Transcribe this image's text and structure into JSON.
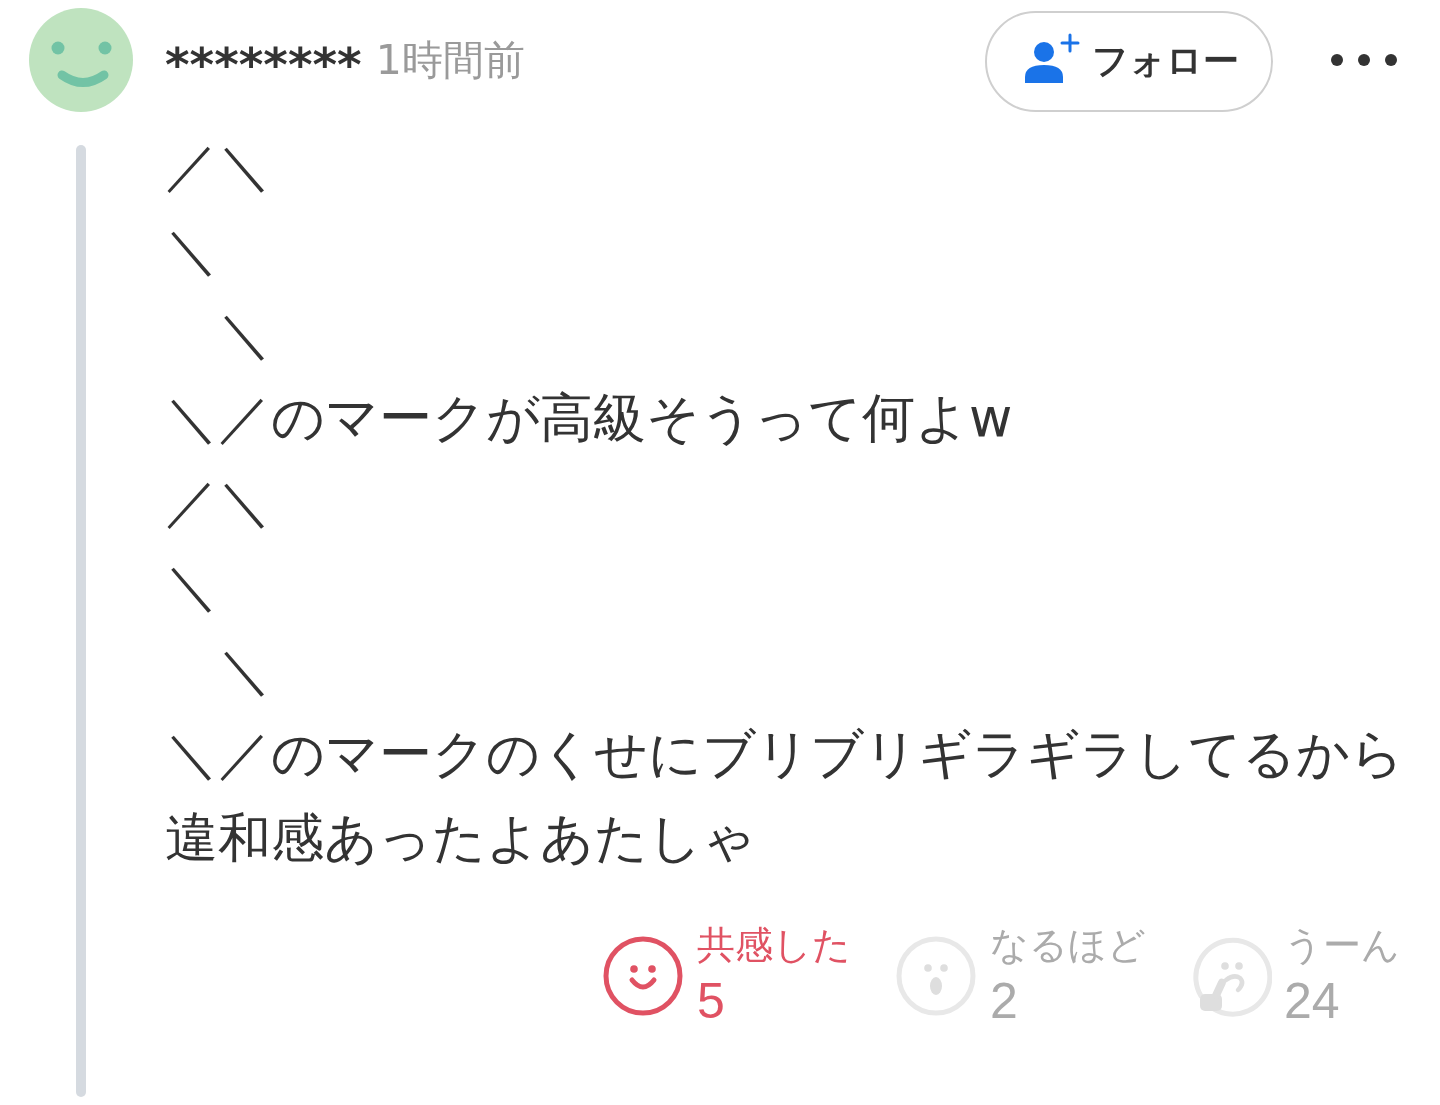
{
  "post": {
    "author": "********",
    "time": "1時間前",
    "follow_button": {
      "label": "フォロー"
    },
    "body_lines": [
      "／＼",
      "＼",
      "　＼",
      "＼／のマークが高級そうって何よw",
      "／＼",
      "＼",
      "　＼",
      "＼／のマークのくせにブリブリギラギラしてるから違和感あったよあたしゃ"
    ],
    "reactions": [
      {
        "kind": "smile",
        "label": "共感した",
        "count": "5",
        "selected": true
      },
      {
        "kind": "surprised",
        "label": "なるほど",
        "count": "2",
        "selected": false
      },
      {
        "kind": "thinking",
        "label": "うーん",
        "count": "24",
        "selected": false
      }
    ]
  }
}
